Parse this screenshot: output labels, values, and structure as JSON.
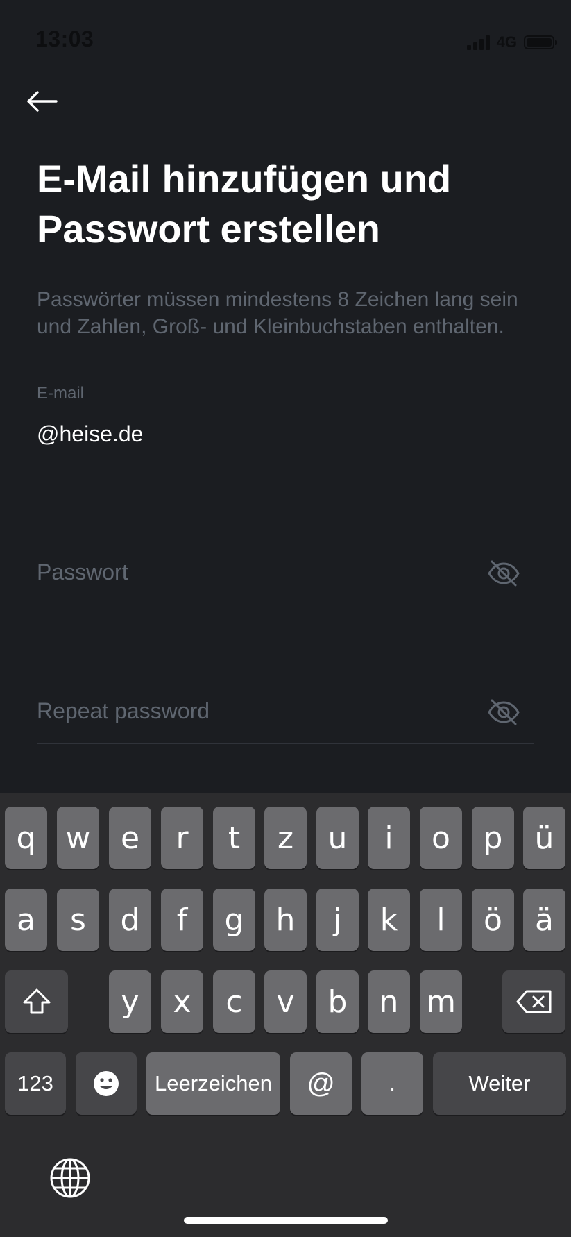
{
  "status_bar": {
    "time": "13:03",
    "network": "4G"
  },
  "header": {
    "back_icon": "arrow-left-icon",
    "title_line1": "E-Mail hinzufügen und",
    "title_line2": "Passwort erstellen",
    "description": "Passwörter müssen mindestens 8 Zeichen lang sein und Zahlen, Groß- und Kleinbuchstaben enthalten."
  },
  "form": {
    "email_label": "E-mail",
    "email_value": "@heise.de",
    "password_placeholder": "Passwort",
    "repeat_password_placeholder": "Repeat password",
    "visibility_icon": "eye-off-icon"
  },
  "keyboard": {
    "row1": [
      "q",
      "w",
      "e",
      "r",
      "t",
      "z",
      "u",
      "i",
      "o",
      "p",
      "ü"
    ],
    "row2": [
      "a",
      "s",
      "d",
      "f",
      "g",
      "h",
      "j",
      "k",
      "l",
      "ö",
      "ä"
    ],
    "row3": [
      "y",
      "x",
      "c",
      "v",
      "b",
      "n",
      "m"
    ],
    "numbers_label": "123",
    "emoji_icon": "emoji-icon",
    "space_label": "Leerzeichen",
    "at_label": "@",
    "period_label": ".",
    "return_label": "Weiter",
    "shift_icon": "shift-icon",
    "delete_icon": "delete-icon",
    "globe_icon": "globe-icon"
  },
  "colors": {
    "background": "#1b1d21",
    "muted_text": "#5f6670",
    "keyboard_background": "#2c2c2e",
    "key_light": "#6b6b6e",
    "key_dark": "#464649"
  }
}
